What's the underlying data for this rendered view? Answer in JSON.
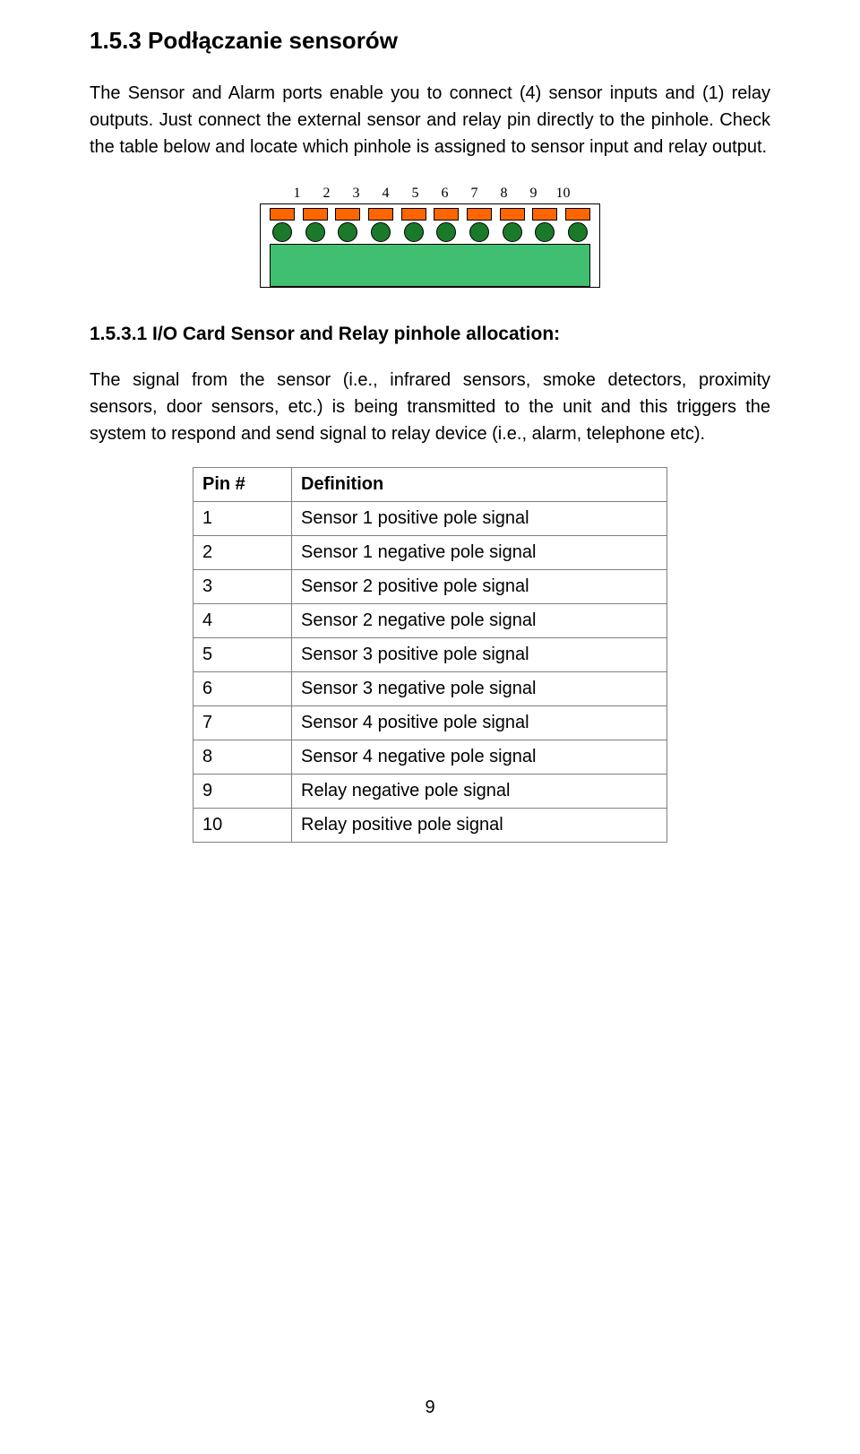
{
  "section": {
    "title": "1.5.3   Podłączanie sensorów",
    "para1": "The Sensor and Alarm ports enable you to connect (4) sensor inputs and (1) relay outputs.  Just connect the external sensor and relay pin directly to the pinhole. Check the table below and locate which pinhole is assigned to sensor input and relay output."
  },
  "diagram": {
    "pin_numbers": [
      "1",
      "2",
      "3",
      "4",
      "5",
      "6",
      "7",
      "8",
      "9",
      "10"
    ]
  },
  "subsection": {
    "title": "1.5.3.1 I/O Card Sensor and Relay pinhole allocation:",
    "para": "The signal from the sensor (i.e., infrared sensors, smoke detectors, proximity sensors, door sensors, etc.) is being transmitted to the unit and this triggers the system to respond and send signal to relay device (i.e., alarm, telephone etc)."
  },
  "table": {
    "headers": {
      "pin": "Pin #",
      "def": "Definition"
    },
    "rows": [
      {
        "pin": "1",
        "def": "Sensor 1 positive pole signal"
      },
      {
        "pin": "2",
        "def": "Sensor 1 negative pole signal"
      },
      {
        "pin": "3",
        "def": "Sensor 2 positive pole signal"
      },
      {
        "pin": "4",
        "def": "Sensor 2 negative pole signal"
      },
      {
        "pin": "5",
        "def": "Sensor 3 positive pole signal"
      },
      {
        "pin": "6",
        "def": "Sensor 3 negative pole signal"
      },
      {
        "pin": "7",
        "def": "Sensor 4 positive pole signal"
      },
      {
        "pin": "8",
        "def": "Sensor 4 negative pole signal"
      },
      {
        "pin": "9",
        "def": "Relay negative pole signal"
      },
      {
        "pin": "10",
        "def": "Relay positive pole signal"
      }
    ]
  },
  "page_number": "9"
}
